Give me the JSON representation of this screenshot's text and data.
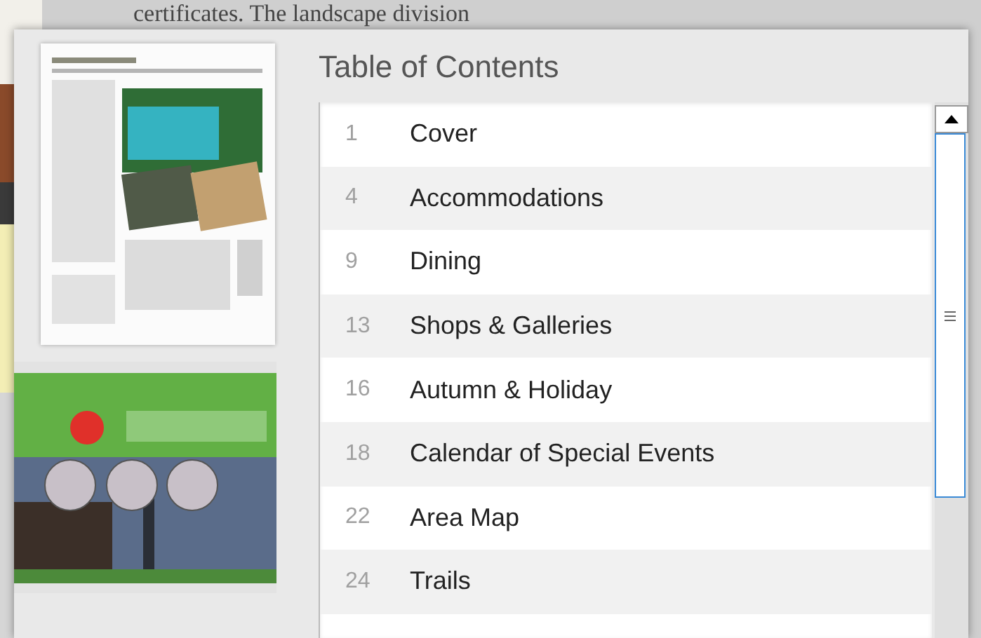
{
  "background_text": "certificates. The landscape division",
  "toc": {
    "title": "Table of Contents",
    "entries": [
      {
        "page": "1",
        "title": "Cover"
      },
      {
        "page": "4",
        "title": "Accommodations"
      },
      {
        "page": "9",
        "title": "Dining"
      },
      {
        "page": "13",
        "title": "Shops & Galleries"
      },
      {
        "page": "16",
        "title": "Autumn & Holiday"
      },
      {
        "page": "18",
        "title": "Calendar of Special Events"
      },
      {
        "page": "22",
        "title": "Area Map"
      },
      {
        "page": "24",
        "title": "Trails"
      }
    ]
  }
}
